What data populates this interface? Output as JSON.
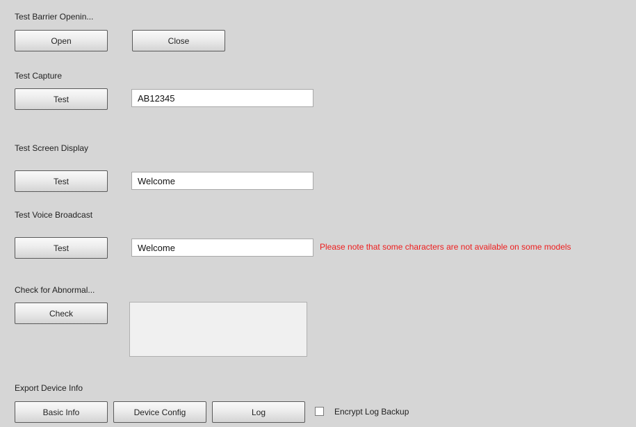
{
  "barrier": {
    "label": "Test Barrier Openin...",
    "open_label": "Open",
    "close_label": "Close"
  },
  "capture": {
    "label": "Test Capture",
    "test_label": "Test",
    "value": "AB12345"
  },
  "screen_display": {
    "label": "Test Screen Display",
    "test_label": "Test",
    "value": "Welcome"
  },
  "voice_broadcast": {
    "label": "Test Voice Broadcast",
    "test_label": "Test",
    "value": "Welcome",
    "note": "Please note that some characters are not available on some models",
    "note_color": "#ee1c1c"
  },
  "abnormal": {
    "label": "Check for Abnormal...",
    "check_label": "Check",
    "result": ""
  },
  "export": {
    "label": "Export Device Info",
    "basic_info_label": "Basic Info",
    "device_config_label": "Device Config",
    "log_label": "Log",
    "encrypt_label": "Encrypt Log Backup",
    "encrypt_checked": false
  },
  "colors": {
    "background": "#d6d6d6",
    "warning": "#ee1c1c"
  }
}
